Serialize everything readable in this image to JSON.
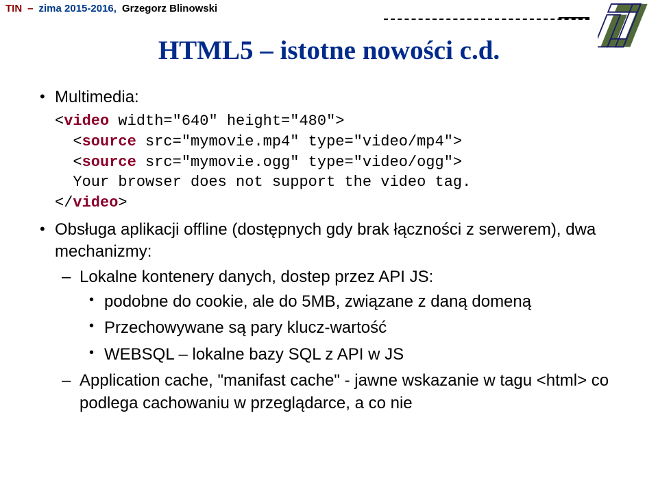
{
  "header": {
    "tin": "TIN",
    "dash": "–",
    "term": "zima 2015-2016,",
    "author": "Grzegorz Blinowski"
  },
  "title": "HTML5 – istotne nowości c.d.",
  "bullet_multimedia": "Multimedia:",
  "code": {
    "l1a": "<",
    "l1b": "video",
    "l1c": " width=\"640\" height=\"480\">",
    "l2a": "  <",
    "l2b": "source",
    "l2c": " src=\"mymovie.mp4\" type=\"video/mp4\">",
    "l3a": "  <",
    "l3b": "source",
    "l3c": " src=\"mymovie.ogg\" type=\"video/ogg\">",
    "l4": "  Your browser does not support the video tag.",
    "l5a": "</",
    "l5b": "video",
    "l5c": ">"
  },
  "bullet_offline": "Obsługa aplikacji offline (dostępnych gdy brak łączności z serwerem), dwa mechanizmy:",
  "sub_localstorage": "Lokalne kontenery danych, dostep przez API JS:",
  "dot_cookie": " podobne do cookie, ale do 5MB, związane z daną domeną",
  "dot_kv": "Przechowywane są pary klucz-wartość",
  "dot_websql": "WEBSQL – lokalne bazy SQL z API w JS",
  "sub_appcache": "Application cache, \"manifast cache\" - jawne wskazanie w tagu <html> co podlega cachowaniu w przeglądarce, a co nie"
}
